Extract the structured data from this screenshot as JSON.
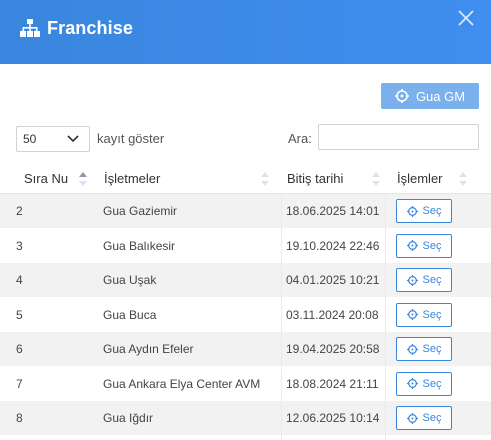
{
  "header": {
    "title": "Franchise",
    "icon": "sitemap-icon",
    "close_icon": "close-icon"
  },
  "toolbar": {
    "gm_button_label": "Gua GM",
    "gm_button_icon": "crosshair-icon"
  },
  "table_controls": {
    "length_value": "50",
    "length_label": "kayıt göster",
    "search_label": "Ara:",
    "search_value": ""
  },
  "table": {
    "columns": [
      "Sıra Nu",
      "İşletmeler",
      "Bitiş tarihi",
      "İşlemler"
    ],
    "action_label": "Seç",
    "rows": [
      {
        "no": "2",
        "name": "Gua Gaziemir",
        "date": "18.06.2025 14:01"
      },
      {
        "no": "3",
        "name": "Gua Balıkesir",
        "date": "19.10.2024 22:46"
      },
      {
        "no": "4",
        "name": "Gua Uşak",
        "date": "04.01.2025 10:21"
      },
      {
        "no": "5",
        "name": "Gua Buca",
        "date": "03.11.2024 20:08"
      },
      {
        "no": "6",
        "name": "Gua Aydın Efeler",
        "date": "19.04.2025 20:58"
      },
      {
        "no": "7",
        "name": "Gua Ankara Elya Center AVM",
        "date": "18.08.2024 21:11"
      },
      {
        "no": "8",
        "name": "Gua Iğdır",
        "date": "12.06.2025 10:14"
      }
    ]
  },
  "colors": {
    "accent": "#3a86de",
    "header_bg": "#3f8ef0",
    "gm_button": "#7ab0ec",
    "row_stripe": "#f2f2f2"
  }
}
